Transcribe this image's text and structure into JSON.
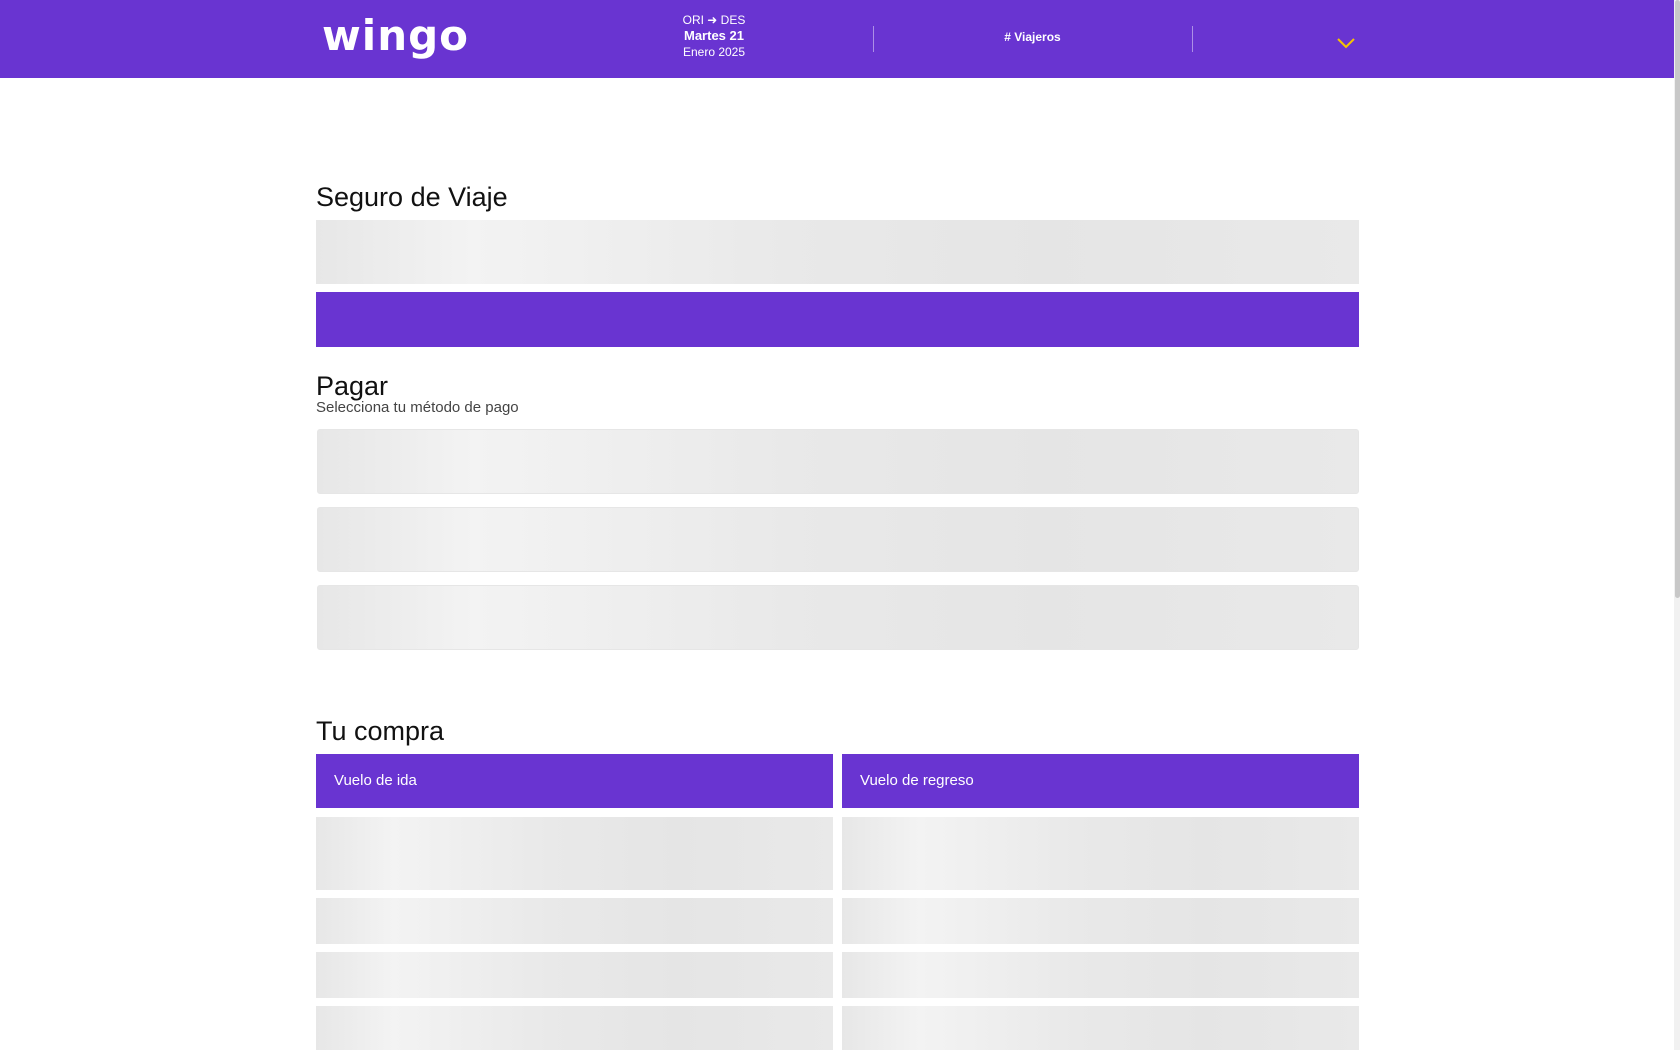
{
  "header": {
    "logo": "wingo",
    "route": "ORI ➜ DES",
    "date_day": "Martes 21",
    "date_month": "Enero 2025",
    "travellers_label": "# Viajeros",
    "accent_color": "#6934d1",
    "chevron_color": "#f5c400",
    "dropdown_icon": "chevron-down-icon"
  },
  "insurance": {
    "title": "Seguro de Viaje"
  },
  "payment": {
    "title": "Pagar",
    "subtitle": "Selecciona tu método de pago"
  },
  "purchase": {
    "title": "Tu compra",
    "tabs": [
      {
        "label": "Vuelo de ida"
      },
      {
        "label": "Vuelo de regreso"
      }
    ]
  }
}
